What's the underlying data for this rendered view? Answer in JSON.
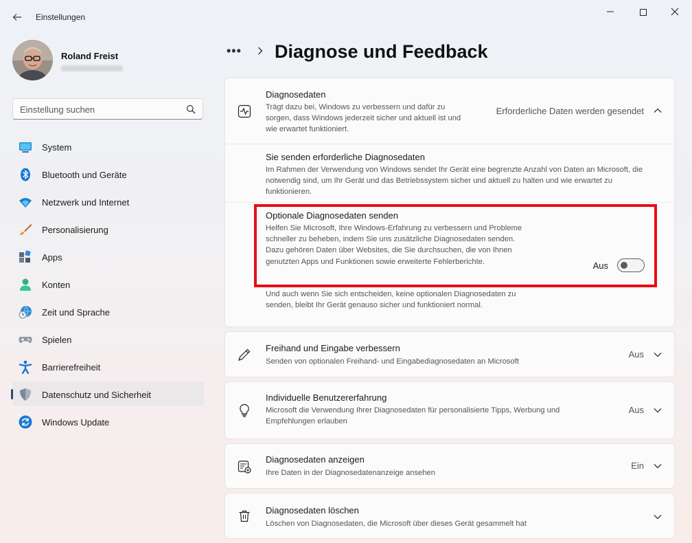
{
  "window": {
    "title": "Einstellungen",
    "back_icon": "arrow-left-icon",
    "controls": [
      "minimize-icon",
      "maximize-icon",
      "close-icon"
    ]
  },
  "profile": {
    "name": "Roland Freist"
  },
  "search": {
    "placeholder": "Einstellung suchen"
  },
  "sidebar": {
    "items": [
      {
        "label": "System",
        "icon": "monitor-icon"
      },
      {
        "label": "Bluetooth und Geräte",
        "icon": "bluetooth-icon"
      },
      {
        "label": "Netzwerk und Internet",
        "icon": "wifi-icon"
      },
      {
        "label": "Personalisierung",
        "icon": "brush-icon"
      },
      {
        "label": "Apps",
        "icon": "apps-icon"
      },
      {
        "label": "Konten",
        "icon": "person-icon"
      },
      {
        "label": "Zeit und Sprache",
        "icon": "globe-clock-icon"
      },
      {
        "label": "Spielen",
        "icon": "gamepad-icon"
      },
      {
        "label": "Barrierefreiheit",
        "icon": "accessibility-icon"
      },
      {
        "label": "Datenschutz und Sicherheit",
        "icon": "shield-icon",
        "active": true
      },
      {
        "label": "Windows Update",
        "icon": "refresh-icon"
      }
    ]
  },
  "breadcrumb": {
    "dots": "•••",
    "title": "Diagnose und Feedback"
  },
  "diagnostics": {
    "title": "Diagnosedaten",
    "desc": "Trägt dazu bei, Windows zu verbessern und dafür zu sorgen, dass Windows jederzeit sicher und aktuell ist und wie erwartet funktioniert.",
    "value": "Erforderliche Daten werden gesendet",
    "required_title": "Sie senden erforderliche Diagnosedaten",
    "required_desc": "Im Rahmen der Verwendung von Windows sendet Ihr Gerät eine begrenzte Anzahl von Daten an Microsoft, die notwendig sind, um Ihr Gerät und das Betriebssystem sicher und aktuell zu halten und wie erwartet zu funktionieren.",
    "optional_title": "Optionale Diagnosedaten senden",
    "optional_desc": "Helfen Sie Microsoft, Ihre Windows-Erfahrung zu verbessern und Probleme schneller zu beheben, indem Sie uns zusätzliche Diagnosedaten senden. Dazu gehören Daten über Websites, die Sie durchsuchen, die von Ihnen genutzten Apps und Funktionen sowie erweiterte Fehlerberichte.",
    "optional_toggle_label": "Aus",
    "optional_enabled": false,
    "optional_note": "Und auch wenn Sie sich entscheiden, keine optionalen Diagnosedaten zu senden, bleibt Ihr Gerät genauso sicher und funktioniert normal.",
    "highlight_color": "#e60f14"
  },
  "rows": [
    {
      "title": "Freihand und Eingabe verbessern",
      "desc": "Senden von optionalen Freihand- und Eingabediagnosedaten an Microsoft",
      "value": "Aus",
      "icon": "pen-icon"
    },
    {
      "title": "Individuelle Benutzererfahrung",
      "desc": "Microsoft die Verwendung Ihrer Diagnosedaten für personalisierte Tipps, Werbung und Empfehlungen erlauben",
      "value": "Aus",
      "icon": "lightbulb-icon"
    },
    {
      "title": "Diagnosedaten anzeigen",
      "desc": "Ihre Daten in der Diagnosedatenanzeige ansehen",
      "value": "Ein",
      "icon": "data-viewer-icon"
    },
    {
      "title": "Diagnosedaten löschen",
      "desc": "Löschen von Diagnosedaten, die Microsoft über dieses Gerät gesammelt hat",
      "value": "",
      "icon": "trash-icon"
    }
  ]
}
